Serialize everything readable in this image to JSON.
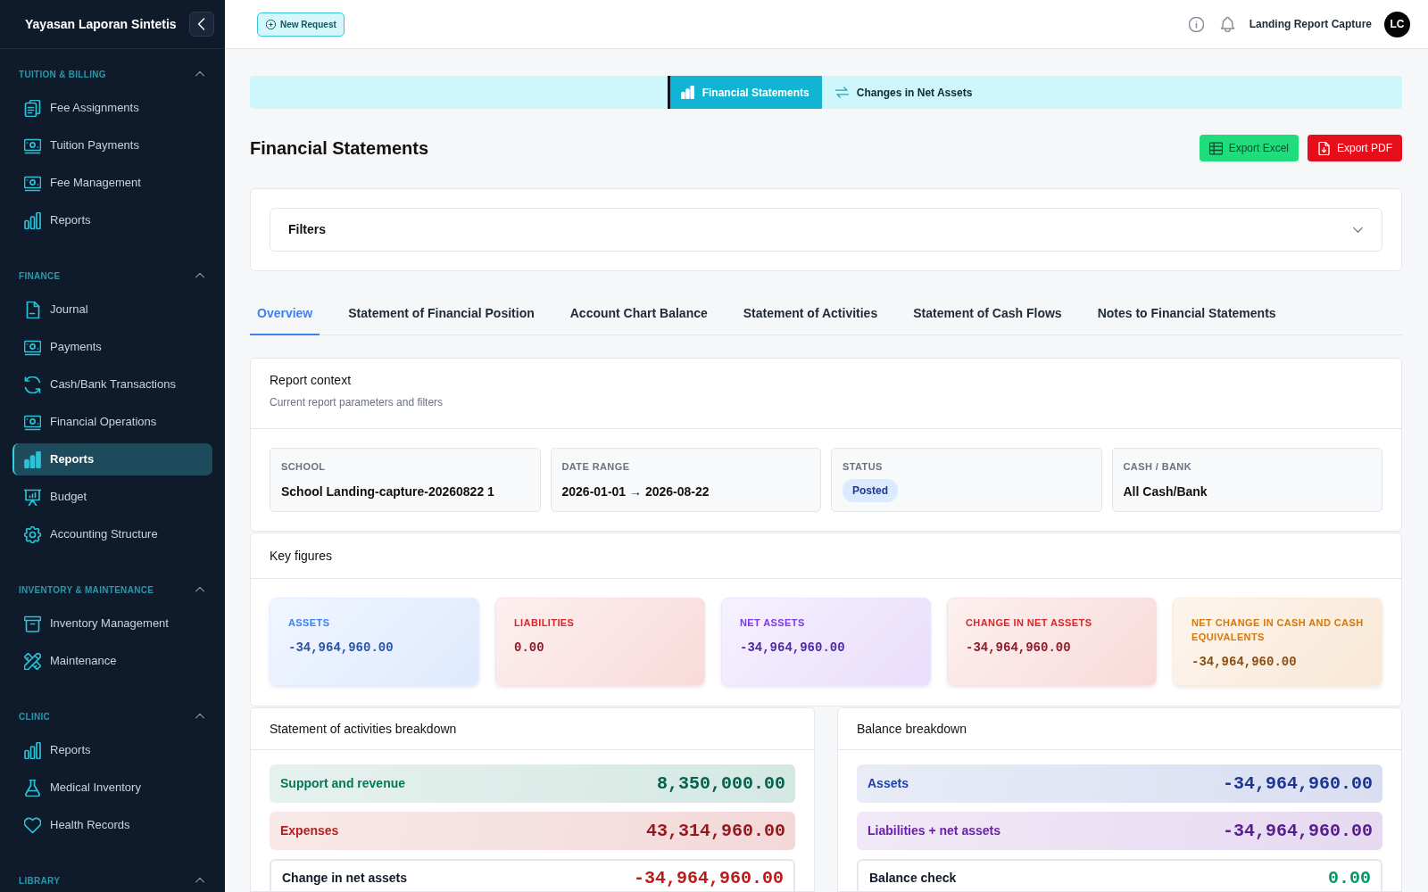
{
  "sidebar": {
    "title": "Yayasan Laporan Sintetis",
    "sections": [
      {
        "label": "TUITION & BILLING",
        "expanded": true,
        "items": [
          {
            "label": "Fee Assignments",
            "selected": false
          },
          {
            "label": "Tuition Payments",
            "selected": false
          },
          {
            "label": "Fee Management",
            "selected": false
          },
          {
            "label": "Reports",
            "selected": false
          }
        ]
      },
      {
        "label": "FINANCE",
        "expanded": true,
        "items": [
          {
            "label": "Journal",
            "selected": false
          },
          {
            "label": "Payments",
            "selected": false
          },
          {
            "label": "Cash/Bank Transactions",
            "selected": false
          },
          {
            "label": "Financial Operations",
            "selected": false
          },
          {
            "label": "Reports",
            "selected": true
          },
          {
            "label": "Budget",
            "selected": false
          },
          {
            "label": "Accounting Structure",
            "selected": false
          }
        ]
      },
      {
        "label": "INVENTORY & MAINTENANCE",
        "expanded": true,
        "items": [
          {
            "label": "Inventory Management",
            "selected": false
          },
          {
            "label": "Maintenance",
            "selected": false
          }
        ]
      },
      {
        "label": "CLINIC",
        "expanded": true,
        "items": [
          {
            "label": "Reports",
            "selected": false
          },
          {
            "label": "Medical Inventory",
            "selected": false
          },
          {
            "label": "Health Records",
            "selected": false
          }
        ]
      },
      {
        "label": "LIBRARY",
        "expanded": true
      }
    ]
  },
  "topbar": {
    "new_request": "New Request",
    "user_name": "Landing Report Capture",
    "avatar_initials": "LC"
  },
  "view_switch": [
    {
      "label": "Financial Statements",
      "selected": true
    },
    {
      "label": "Changes in Net Assets",
      "selected": false
    }
  ],
  "page": {
    "title": "Financial Statements",
    "buttons": [
      {
        "label": "Export Excel",
        "kind": "excel"
      },
      {
        "label": "Export PDF",
        "kind": "pdf"
      }
    ]
  },
  "filters": {
    "label": "Filters",
    "expanded": false
  },
  "tabs": [
    {
      "label": "Overview",
      "selected": true
    },
    {
      "label": "Statement of Financial Position",
      "selected": false
    },
    {
      "label": "Account Chart Balance",
      "selected": false
    },
    {
      "label": "Statement of Activities",
      "selected": false
    },
    {
      "label": "Statement of Cash Flows",
      "selected": false
    },
    {
      "label": "Notes to Financial Statements",
      "selected": false
    }
  ],
  "report_context": {
    "title": "Report context",
    "subtitle": "Current report parameters and filters",
    "fields": [
      {
        "label": "SCHOOL",
        "value": "School Landing-capture-20260822 1",
        "kind": "text"
      },
      {
        "label": "DATE RANGE",
        "value": "2026-01-01 → 2026-08-22",
        "kind": "text"
      },
      {
        "label": "STATUS",
        "value": "Posted",
        "kind": "badge"
      },
      {
        "label": "CASH / BANK",
        "value": "All Cash/Bank",
        "kind": "text"
      }
    ]
  },
  "key_figures": {
    "title": "Key figures",
    "items": [
      {
        "label": "ASSETS",
        "value": "-34,964,960.00",
        "color": "#3b82f6"
      },
      {
        "label": "LIABILITIES",
        "value": "0.00",
        "color": "#dc2626"
      },
      {
        "label": "NET ASSETS",
        "value": "-34,964,960.00",
        "color": "#7c3aed"
      },
      {
        "label": "CHANGE IN NET ASSETS",
        "value": "-34,964,960.00",
        "color": "#dc2626"
      },
      {
        "label": "NET CHANGE IN CASH AND CASH EQUIVALENTS",
        "value": "-34,964,960.00",
        "color": "#d97706"
      }
    ]
  },
  "activities_breakdown": {
    "title": "Statement of activities breakdown",
    "rows": [
      {
        "label": "Support and revenue",
        "value": "8,350,000.00",
        "kind": "tinted",
        "color": "#047857"
      },
      {
        "label": "Expenses",
        "value": "43,314,960.00",
        "kind": "tinted",
        "color": "#b91c1c"
      },
      {
        "label": "Change in net assets",
        "value": "-34,964,960.00",
        "kind": "outlined",
        "color": "#b91c1c"
      }
    ]
  },
  "balance_breakdown": {
    "title": "Balance breakdown",
    "rows": [
      {
        "label": "Assets",
        "value": "-34,964,960.00",
        "kind": "tinted",
        "color": "#1e40af"
      },
      {
        "label": "Liabilities + net assets",
        "value": "-34,964,960.00",
        "kind": "tinted",
        "color": "#6b21a8"
      },
      {
        "label": "Balance check",
        "value": "0.00",
        "kind": "outlined",
        "color": "#059669"
      }
    ]
  }
}
